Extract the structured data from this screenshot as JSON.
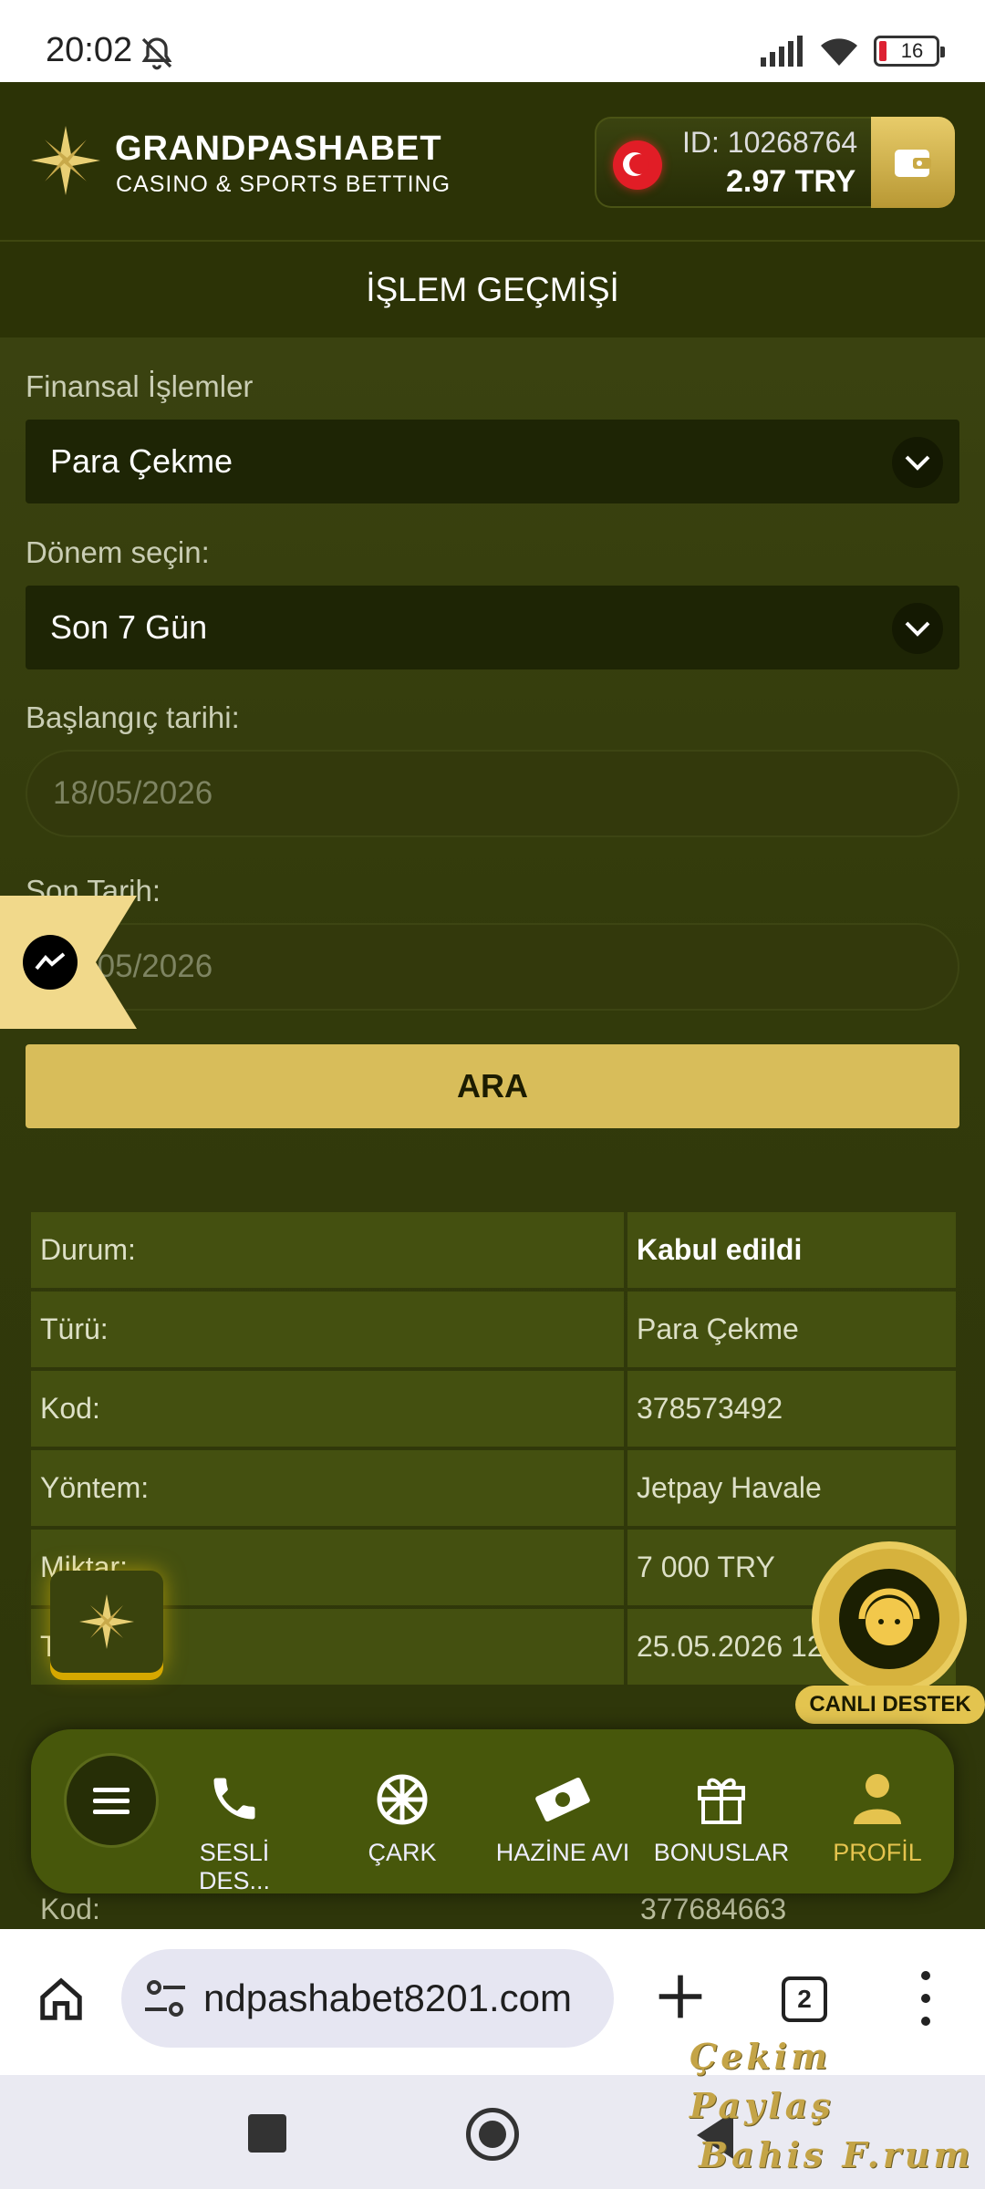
{
  "status_bar": {
    "time": "20:02",
    "battery": "16"
  },
  "header": {
    "brand": "GRANDPASHABET",
    "brand_sub": "CASINO & SPORTS BETTING",
    "account_id": "ID: 10268764",
    "balance": "2.97   TRY"
  },
  "page_title": "İŞLEM GEÇMİŞİ",
  "filters": {
    "type_label": "Finansal İşlemler",
    "type_value": "Para Çekme",
    "period_label": "Dönem seçin:",
    "period_value": "Son 7 Gün",
    "start_label": "Başlangıç tarihi:",
    "start_value": "18/05/2026",
    "end_label": "Son Tarih:",
    "end_value": "25/05/2026",
    "search_button": "ARA"
  },
  "transaction": {
    "rows": [
      {
        "key": "Durum:",
        "value": "Kabul edildi"
      },
      {
        "key": "Türü:",
        "value": "Para Çekme"
      },
      {
        "key": "Kod:",
        "value": "378573492"
      },
      {
        "key": "Yöntem:",
        "value": "Jetpay Havale"
      },
      {
        "key": "Miktar:",
        "value": "7 000 TRY"
      },
      {
        "key": "Tarih:",
        "value": "25.05.2026 12"
      }
    ]
  },
  "next_row": {
    "key": "Kod:",
    "value": "377684663"
  },
  "support_label": "CANLI DESTEK",
  "bottom_nav": {
    "items": [
      {
        "label": "SESLİ DES...",
        "icon": "phone-icon"
      },
      {
        "label": "ÇARK",
        "icon": "wheel-icon"
      },
      {
        "label": "HAZİNE AVI",
        "icon": "treasure-icon"
      },
      {
        "label": "BONUSLAR",
        "icon": "gift-icon"
      },
      {
        "label": "PROFİL",
        "icon": "user-icon"
      }
    ]
  },
  "browser": {
    "url": "ndpashabet8201.com",
    "tab_count": "2"
  },
  "watermark": {
    "line1": "Çekim Paylaş",
    "line2": "Bahis F.rum"
  },
  "colors": {
    "accent": "#d8bd5a",
    "background": "#2b3208",
    "active_nav": "#e5c34e"
  }
}
